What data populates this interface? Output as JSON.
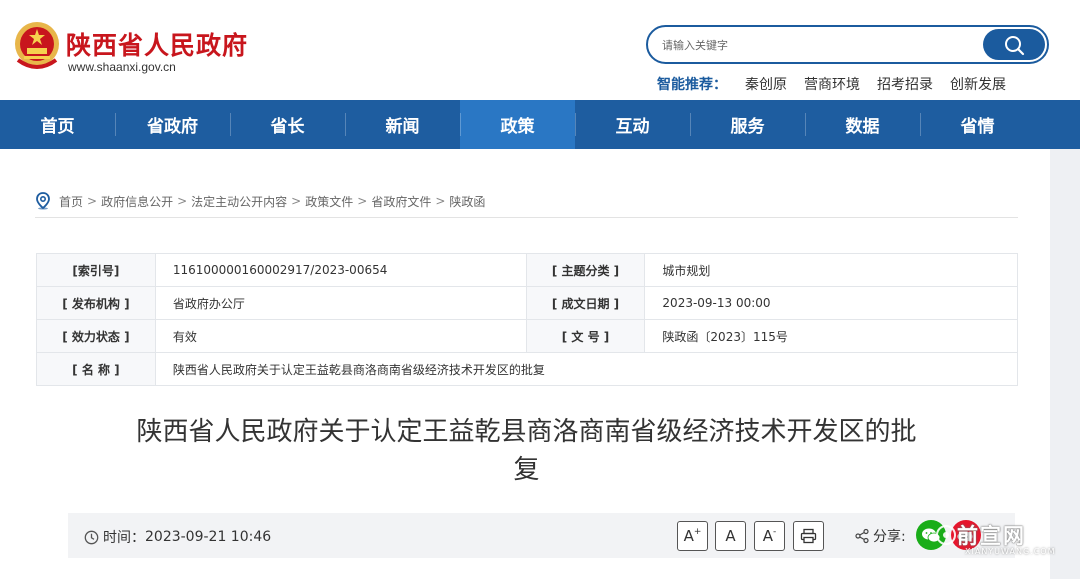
{
  "header": {
    "site_title": "陕西省人民政府",
    "site_url": "www.shaanxi.gov.cn",
    "search_placeholder": "请输入关键字",
    "recommend_label": "智能推荐：",
    "recommend_items": [
      "秦创原",
      "营商环境",
      "招考招录",
      "创新发展"
    ]
  },
  "nav": {
    "items": [
      "首页",
      "省政府",
      "省长",
      "新闻",
      "政策",
      "互动",
      "服务",
      "数据",
      "省情"
    ],
    "active_index": 4
  },
  "breadcrumb": [
    "首页",
    "政府信息公开",
    "法定主动公开内容",
    "政策文件",
    "省政府文件",
    "陕政函"
  ],
  "meta_table": {
    "rows": [
      {
        "k1": "[索引号]",
        "v1": "116100000160002917/2023-00654",
        "k2": "[ 主题分类 ]",
        "v2": "城市规划"
      },
      {
        "k1": "[ 发布机构 ]",
        "v1": "省政府办公厅",
        "k2": "[ 成文日期 ]",
        "v2": "2023-09-13 00:00"
      },
      {
        "k1": "[ 效力状态 ]",
        "v1": "有效",
        "k2": "[ 文 号 ]",
        "v2": "陕政函〔2023〕115号"
      },
      {
        "k1": "[ 名 称 ]",
        "v1": "陕西省人民政府关于认定王益乾县商洛商南省级经济技术开发区的批复"
      }
    ]
  },
  "document": {
    "title_line1": "陕西省人民政府关于认定王益乾县商洛商南省级经济技术开发区的批",
    "title_line2": "复"
  },
  "info_bar": {
    "time_label": "时间：",
    "time_value": "2023-09-21 10:46",
    "font_large": "A",
    "font_large_sup": "+",
    "font_normal": "A",
    "font_small": "A",
    "font_small_sup": "-",
    "share_label": "分享:"
  },
  "watermark": {
    "text": "前宣网",
    "sub": "XIANYUWANG.COM"
  },
  "colors": {
    "brand_red": "#c8161d",
    "nav_blue": "#1e5da0",
    "nav_active": "#2a77c4",
    "search_blue": "#1b5b9e"
  },
  "icons": {
    "emblem": "national-emblem",
    "search": "search-icon",
    "location": "location-pin-icon",
    "clock": "clock-icon",
    "print": "printer-icon",
    "share": "share-icon",
    "wechat": "wechat-icon",
    "weibo": "weibo-icon"
  }
}
